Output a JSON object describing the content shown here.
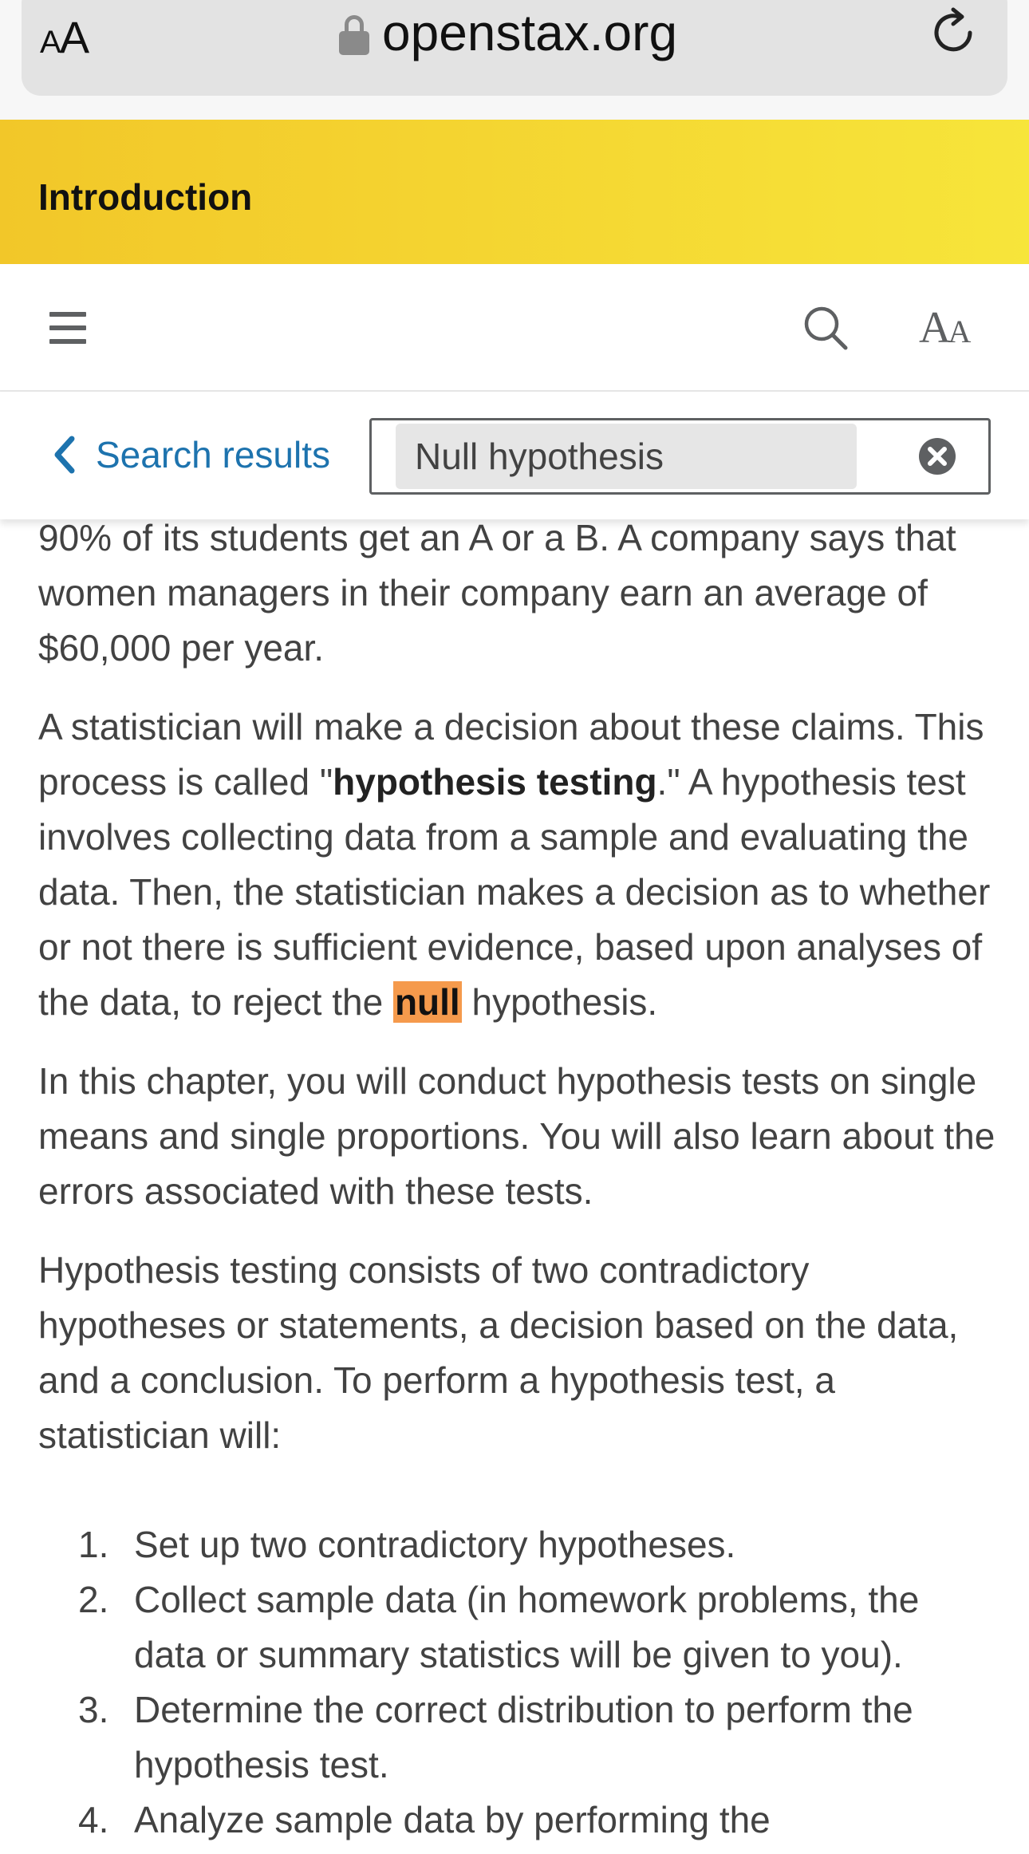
{
  "browser": {
    "text_size_label_small": "A",
    "text_size_label_large": "A",
    "url": "openstax.org"
  },
  "banner": {
    "title": "Introduction"
  },
  "toolbar": {
    "font_size_small": "A",
    "font_size_large": "A"
  },
  "search": {
    "back_label": "Search results",
    "query": "Null hypothesis"
  },
  "content": {
    "p1": "90% of its students get an A or a B. A company says that women managers in their company earn an average of $60,000 per year.",
    "p2_before": "A statistician will make a decision about these claims. This process is called \"",
    "p2_bold": "hypothesis testing",
    "p2_mid": ".\" A hypothesis test involves collecting data from a sample and evaluating the data. Then, the statistician makes a decision as to whether or not there is sufficient evidence, based upon analyses of the data, to reject the ",
    "p2_highlight": "null",
    "p2_after": " hypothesis.",
    "p3": "In this chapter, you will conduct hypothesis tests on single means and single proportions. You will also learn about the errors associated with these tests.",
    "p4": "Hypothesis testing consists of two contradictory hypotheses or statements, a decision based on the data, and a conclusion. To perform a hypothesis test, a statistician will:",
    "steps": [
      {
        "num": "1.",
        "text": "Set up two contradictory hypotheses."
      },
      {
        "num": "2.",
        "text": "Collect sample data (in homework problems, the data or summary statistics will be given to you)."
      },
      {
        "num": "3.",
        "text": "Determine the correct distribution to perform the hypothesis test."
      },
      {
        "num": "4.",
        "text": "Analyze sample data by performing the"
      }
    ]
  },
  "colors": {
    "banner_start": "#f2c729",
    "banner_end": "#f7e53a",
    "link": "#1d73ae",
    "highlight": "#f59a4c"
  },
  "icons": [
    "lock-icon",
    "reload-icon",
    "hamburger-icon",
    "search-icon",
    "font-size-icon",
    "chevron-left-icon",
    "clear-icon"
  ]
}
